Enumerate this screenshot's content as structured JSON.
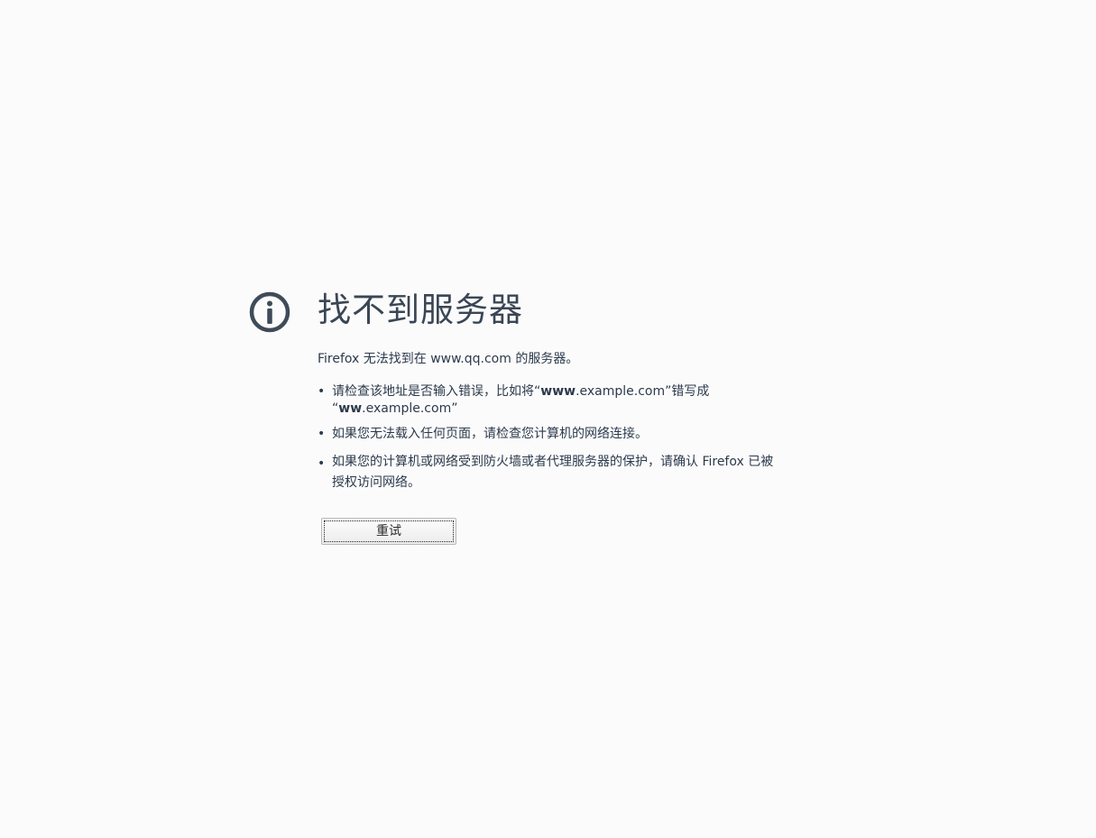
{
  "error_page": {
    "title": "找不到服务器",
    "intro": "Firefox 无法找到在 www.qq.com 的服务器。",
    "hints": {
      "hint1": {
        "before": "请检查该地址是否输入错误，比如将“",
        "bold1": "www",
        "mid": ".example.com”错写成 “",
        "bold2": "ww",
        "after": ".example.com”"
      },
      "hint2": "如果您无法载入任何页面，请检查您计算机的网络连接。",
      "hint3": "如果您的计算机或网络受到防火墙或者代理服务器的保护，请确认 Firefox 已被授权访问网络。"
    },
    "bullet": "•",
    "retry_label": "重试"
  },
  "icons": {
    "info": "info-icon"
  },
  "colors": {
    "background": "#fbfbfc",
    "text": "#2c3a4b",
    "icon": "#3f4b58"
  }
}
